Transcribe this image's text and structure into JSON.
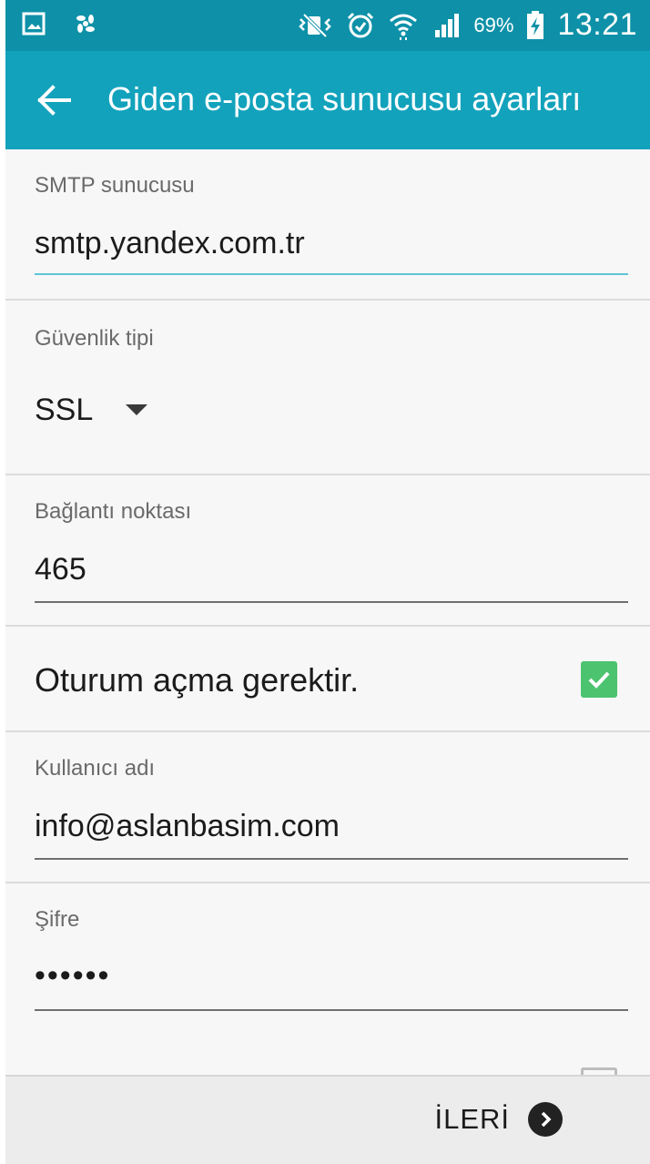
{
  "status_bar": {
    "battery_text": "69%",
    "time": "13:21",
    "icons": [
      "gallery-icon",
      "pinwheel-icon",
      "vibrate-mute-icon",
      "alarm-icon",
      "wifi-icon",
      "signal-icon",
      "battery-charging-icon"
    ]
  },
  "app_bar": {
    "title": "Giden e-posta sunucusu ayarları",
    "back_icon": "arrow-back-icon"
  },
  "form": {
    "smtp": {
      "label": "SMTP sunucusu",
      "value": "smtp.yandex.com.tr"
    },
    "security": {
      "label": "Güvenlik tipi",
      "selected": "SSL"
    },
    "port": {
      "label": "Bağlantı noktası",
      "value": "465"
    },
    "auth": {
      "label": "Oturum açma gerektir.",
      "checked": true
    },
    "username": {
      "label": "Kullanıcı adı",
      "value": "info@aslanbasim.com"
    },
    "password": {
      "label": "Şifre",
      "value": "••••••"
    }
  },
  "bottom_bar": {
    "next_label": "İLERİ",
    "next_icon": "chevron-right-circle-icon"
  },
  "colors": {
    "status_bar": "#0e91a8",
    "app_bar": "#12a2bc",
    "focus_underline": "#5cc4d4",
    "checkbox": "#4cc36f"
  }
}
